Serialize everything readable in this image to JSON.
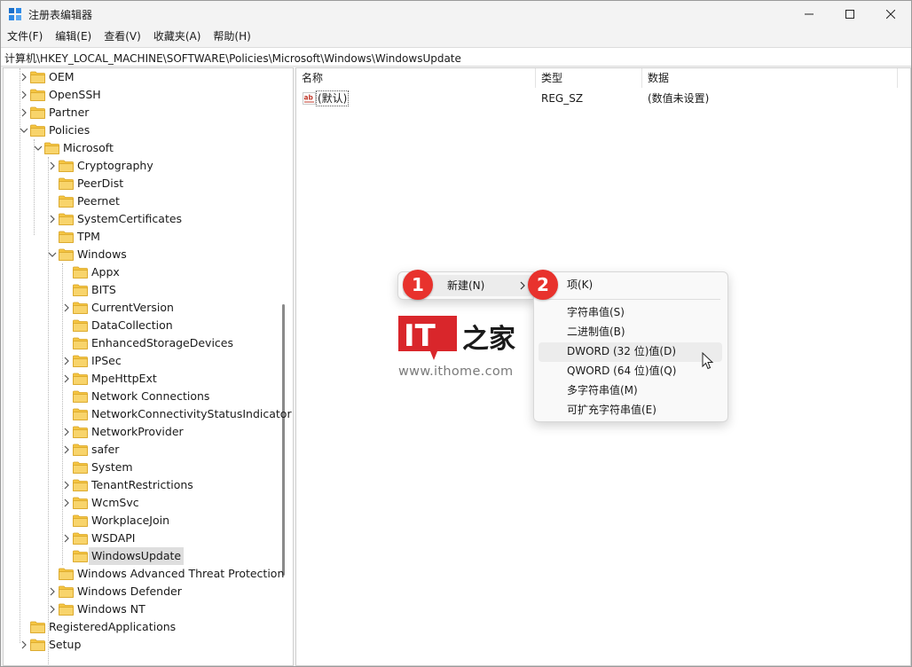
{
  "window": {
    "title": "注册表编辑器"
  },
  "menubar": [
    "文件(F)",
    "编辑(E)",
    "查看(V)",
    "收藏夹(A)",
    "帮助(H)"
  ],
  "address": "计算机\\HKEY_LOCAL_MACHINE\\SOFTWARE\\Policies\\Microsoft\\Windows\\WindowsUpdate",
  "tree": [
    {
      "label": "OEM",
      "level": 0,
      "expand": "collapsed"
    },
    {
      "label": "OpenSSH",
      "level": 0,
      "expand": "collapsed"
    },
    {
      "label": "Partner",
      "level": 0,
      "expand": "collapsed"
    },
    {
      "label": "Policies",
      "level": 0,
      "expand": "expanded"
    },
    {
      "label": "Microsoft",
      "level": 1,
      "expand": "expanded"
    },
    {
      "label": "Cryptography",
      "level": 2,
      "expand": "collapsed"
    },
    {
      "label": "PeerDist",
      "level": 2,
      "expand": "none"
    },
    {
      "label": "Peernet",
      "level": 2,
      "expand": "none"
    },
    {
      "label": "SystemCertificates",
      "level": 2,
      "expand": "collapsed"
    },
    {
      "label": "TPM",
      "level": 2,
      "expand": "none"
    },
    {
      "label": "Windows",
      "level": 2,
      "expand": "expanded"
    },
    {
      "label": "Appx",
      "level": 3,
      "expand": "none"
    },
    {
      "label": "BITS",
      "level": 3,
      "expand": "none"
    },
    {
      "label": "CurrentVersion",
      "level": 3,
      "expand": "collapsed"
    },
    {
      "label": "DataCollection",
      "level": 3,
      "expand": "none"
    },
    {
      "label": "EnhancedStorageDevices",
      "level": 3,
      "expand": "none"
    },
    {
      "label": "IPSec",
      "level": 3,
      "expand": "collapsed"
    },
    {
      "label": "MpeHttpExt",
      "level": 3,
      "expand": "collapsed"
    },
    {
      "label": "Network Connections",
      "level": 3,
      "expand": "none"
    },
    {
      "label": "NetworkConnectivityStatusIndicator",
      "level": 3,
      "expand": "none"
    },
    {
      "label": "NetworkProvider",
      "level": 3,
      "expand": "collapsed"
    },
    {
      "label": "safer",
      "level": 3,
      "expand": "collapsed"
    },
    {
      "label": "System",
      "level": 3,
      "expand": "none"
    },
    {
      "label": "TenantRestrictions",
      "level": 3,
      "expand": "collapsed"
    },
    {
      "label": "WcmSvc",
      "level": 3,
      "expand": "collapsed"
    },
    {
      "label": "WorkplaceJoin",
      "level": 3,
      "expand": "none"
    },
    {
      "label": "WSDAPI",
      "level": 3,
      "expand": "collapsed"
    },
    {
      "label": "WindowsUpdate",
      "level": 3,
      "expand": "none",
      "selected": true
    },
    {
      "label": "Windows Advanced Threat Protection",
      "level": 2,
      "expand": "none"
    },
    {
      "label": "Windows Defender",
      "level": 2,
      "expand": "collapsed"
    },
    {
      "label": "Windows NT",
      "level": 2,
      "expand": "collapsed"
    },
    {
      "label": "RegisteredApplications",
      "level": 0,
      "expand": "none"
    },
    {
      "label": "Setup",
      "level": 0,
      "expand": "collapsed"
    }
  ],
  "columns": {
    "name": "名称",
    "type": "类型",
    "data": "数据"
  },
  "values": [
    {
      "name": "(默认)",
      "type": "REG_SZ",
      "data": "(数值未设置)"
    }
  ],
  "context_menu": {
    "new_label": "新建(N)"
  },
  "submenu": {
    "key": "项(K)",
    "items": [
      "字符串值(S)",
      "二进制值(B)",
      "DWORD (32 位)值(D)",
      "QWORD (64 位)值(Q)",
      "多字符串值(M)",
      "可扩充字符串值(E)"
    ]
  },
  "badges": [
    "1",
    "2"
  ],
  "logo": {
    "letters": "IT",
    "glyphs": "之家",
    "url": "www.ithome.com"
  },
  "colors": {
    "badge": "#e8322d",
    "logo_red": "#d9262b",
    "folder": "#f5c542"
  }
}
